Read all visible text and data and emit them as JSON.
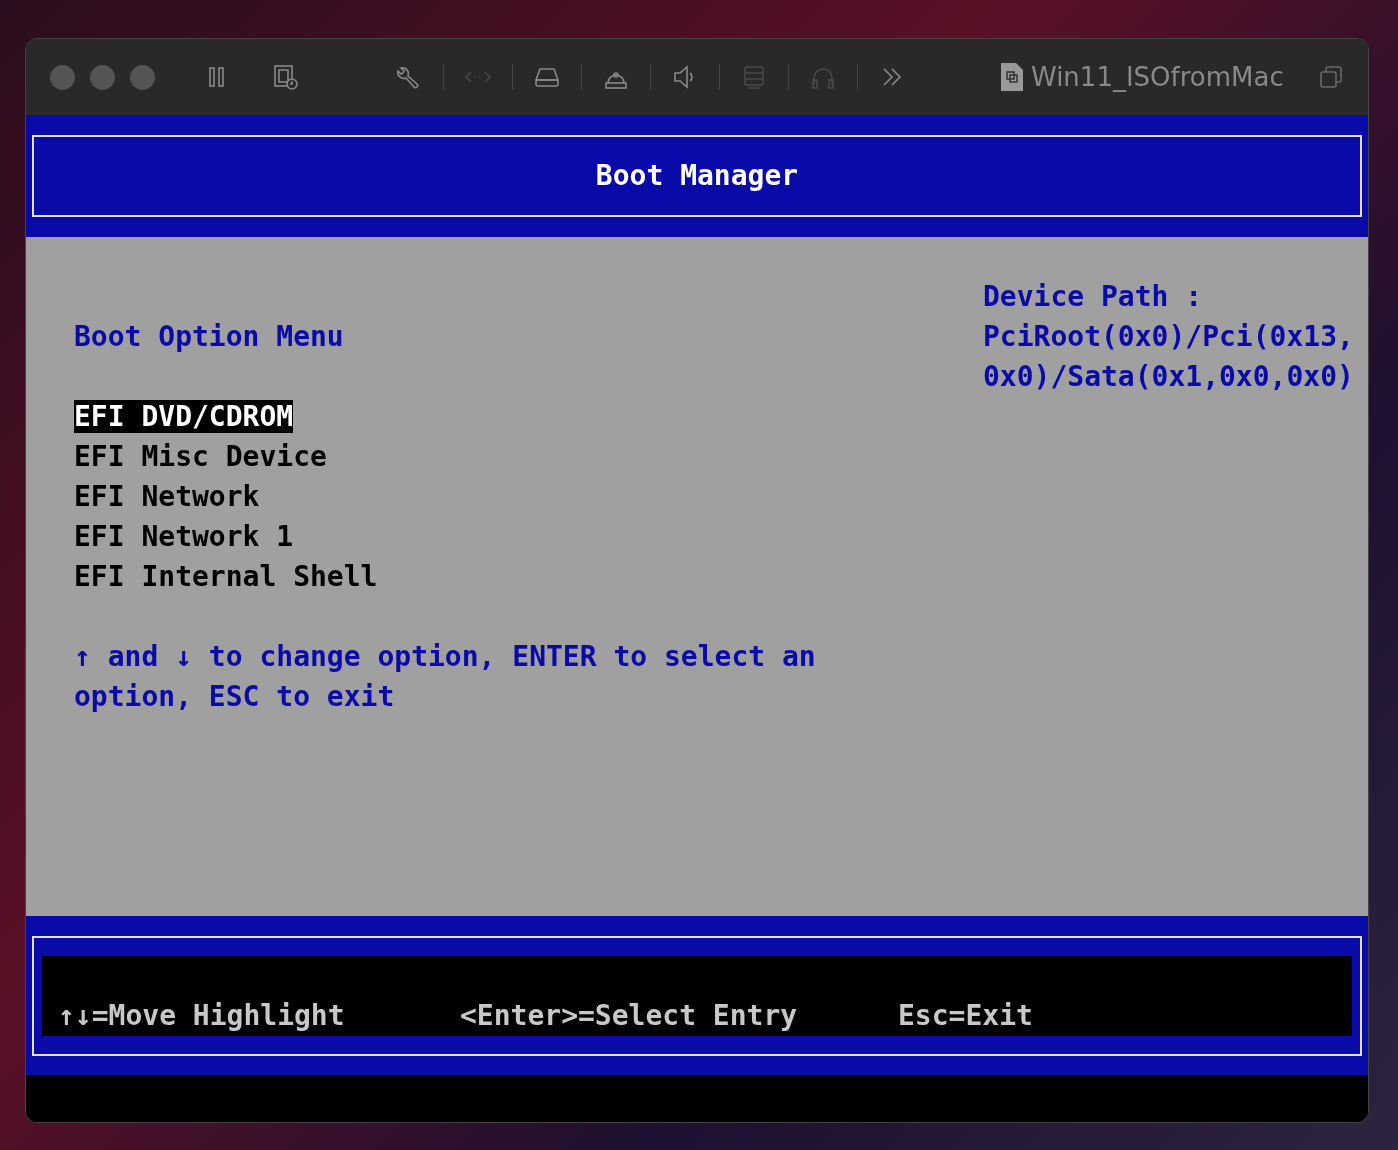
{
  "window": {
    "title": "Win11_ISOfromMac"
  },
  "toolbar": [
    {
      "kind": "pause",
      "disabled": false
    },
    {
      "kind": "snapshot",
      "disabled": false
    },
    {
      "kind": "wrench",
      "disabled": false
    },
    {
      "kind": "network",
      "disabled": true
    },
    {
      "kind": "drive",
      "disabled": false
    },
    {
      "kind": "camera",
      "disabled": false
    },
    {
      "kind": "speaker",
      "disabled": false
    },
    {
      "kind": "list",
      "disabled": true
    },
    {
      "kind": "headphones",
      "disabled": true
    },
    {
      "kind": "more",
      "disabled": false
    }
  ],
  "screen": {
    "title": "Boot Manager",
    "section": "Boot Option Menu",
    "options": [
      {
        "label": "EFI DVD/CDROM",
        "selected": true
      },
      {
        "label": "EFI Misc Device",
        "selected": false
      },
      {
        "label": "EFI Network",
        "selected": false
      },
      {
        "label": "EFI Network 1",
        "selected": false
      },
      {
        "label": "EFI Internal Shell",
        "selected": false
      }
    ],
    "help": "↑ and ↓ to change option, ENTER to select an option, ESC to exit",
    "device_path_label": "Device Path :",
    "device_path": "PciRoot(0x0)/Pci(0x13,0x0)/Sata(0x1,0x0,0x0)",
    "footer": [
      "↑↓=Move Highlight",
      "<Enter>=Select Entry",
      "Esc=Exit"
    ]
  }
}
